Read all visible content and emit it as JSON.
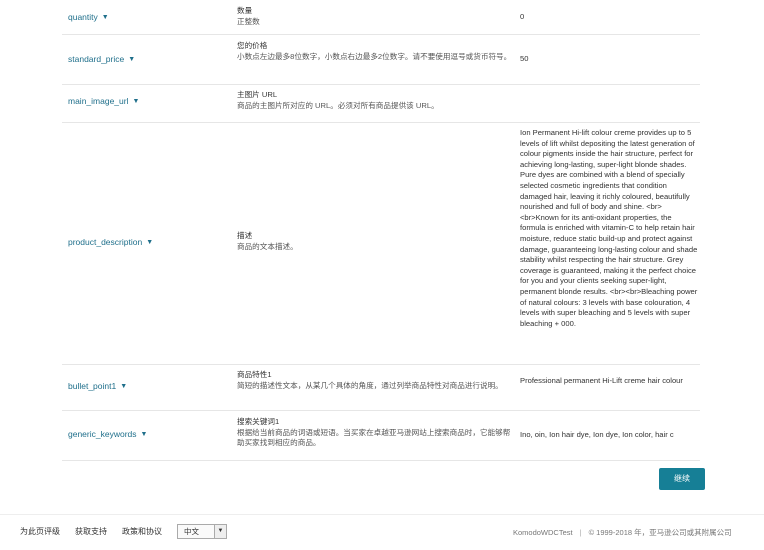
{
  "rows": [
    {
      "field": "quantity",
      "label": "数量",
      "text": "正整数",
      "value": "0"
    },
    {
      "field": "standard_price",
      "label": "您的价格",
      "text": "小数点左边最多8位数字，小数点右边最多2位数字。请不要使用逗号或货币符号。",
      "value": "50"
    },
    {
      "field": "main_image_url",
      "label": "主图片 URL",
      "text": "商品的主图片所对应的 URL。必须对所有商品提供该 URL。",
      "value": ""
    },
    {
      "field": "product_description",
      "label": "描述",
      "text": "商品的文本描述。",
      "value": "Ion Permanent Hi-lift colour creme provides up to 5 levels of lift whilst depositing the latest generation of colour pigments inside the hair structure, perfect for achieving long-lasting, super-light blonde shades. Pure dyes are combined with a blend of specially selected cosmetic ingredients that condition damaged hair, leaving it richly coloured, beautifully nourished and full of body and shine. <br><br>Known for its anti-oxidant properties, the formula is enriched with vitamin-C to help retain hair moisture, reduce static build-up and protect against damage, guaranteeing long-lasting colour and shade stability whilst respecting the hair structure. Grey coverage is guaranteed, making it the perfect choice for you and your clients seeking super-light, permanent blonde results. <br><br>Bleaching power of natural colours: 3 levels with base colouration, 4 levels with super bleaching and 5 levels with super bleaching + 000."
    },
    {
      "field": "bullet_point1",
      "label": "商品特性1",
      "text": "简短的描述性文本，从某几个具体的角度，通过列举商品特性对商品进行说明。",
      "value": "Professional permanent Hi-Lift creme hair colour"
    },
    {
      "field": "generic_keywords",
      "label": "搜索关键词1",
      "text": "根据给当前商品的词语或短语。当买家在卓越亚马逊网站上搜索商品时，它能够帮助买家找到相应的商品。",
      "value": "Ino, oin, Ion hair dye, Ion dye, Ion color, hair c"
    }
  ],
  "continue_label": "继续",
  "footer": {
    "links": [
      "为此页评级",
      "获取支持",
      "政策和协议"
    ],
    "language": "中文",
    "brand": "KomodoWDCTest",
    "copyright": "© 1999-2018 年，亚马逊公司或其附属公司"
  },
  "icons": {
    "field_chevron": "chevron-down-icon",
    "select_arrow": "dropdown-arrow-icon"
  },
  "colors": {
    "field_link": "#1f6f8b",
    "primary_button": "#167f96"
  }
}
